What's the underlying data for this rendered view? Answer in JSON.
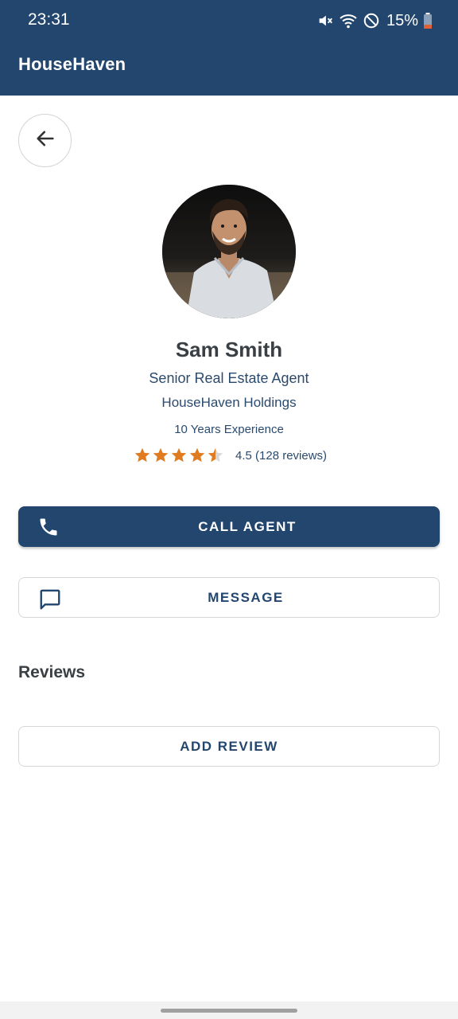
{
  "status_bar": {
    "time": "23:31",
    "battery_percent": "15%",
    "icons": [
      "mute-icon",
      "wifi-icon",
      "do-not-disturb-icon",
      "battery-icon"
    ]
  },
  "header": {
    "title": "HouseHaven"
  },
  "navigation": {
    "back_icon": "arrow-left-icon"
  },
  "agent": {
    "name": "Sam Smith",
    "title": "Senior Real Estate Agent",
    "company": "HouseHaven Holdings",
    "experience": "10 Years Experience",
    "rating_value": 4.5,
    "rating_max": 5,
    "rating_text": "4.5 (128 reviews)",
    "star_color": "#e07b1f"
  },
  "actions": {
    "call_label": "CALL AGENT",
    "call_icon": "phone-icon",
    "message_label": "MESSAGE",
    "message_icon": "chat-bubble-icon"
  },
  "reviews": {
    "heading": "Reviews",
    "add_label": "ADD REVIEW"
  },
  "colors": {
    "primary": "#22466e",
    "accent": "#e07b1f"
  }
}
